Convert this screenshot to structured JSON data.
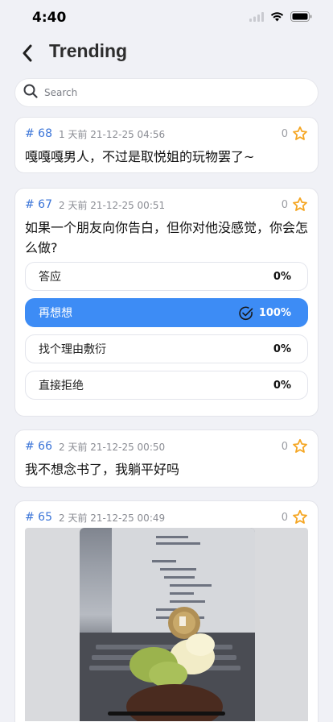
{
  "status": {
    "time": "4:40"
  },
  "header": {
    "title": "Trending"
  },
  "search": {
    "placeholder": "Search"
  },
  "posts": [
    {
      "id": "# 68",
      "meta": "1 天前 21-12-25 04:56",
      "fav_count": "0",
      "text": "嘎嘎嘎男人，不过是取悦姐的玩物罢了~"
    },
    {
      "id": "# 67",
      "meta": "2 天前 21-12-25 00:51",
      "fav_count": "0",
      "text": "如果一个朋友向你告白，但你对他没感觉，你会怎么做?",
      "poll": [
        {
          "label": "答应",
          "percent": "0%",
          "selected": false
        },
        {
          "label": "再想想",
          "percent": "100%",
          "selected": true
        },
        {
          "label": "找个理由敷衍",
          "percent": "0%",
          "selected": false
        },
        {
          "label": "直接拒绝",
          "percent": "0%",
          "selected": false
        }
      ]
    },
    {
      "id": "# 66",
      "meta": "2 天前 21-12-25 00:50",
      "fav_count": "0",
      "text": "我不想念书了，我躺平好吗"
    },
    {
      "id": "# 65",
      "meta": "2 天前 21-12-25 00:49",
      "fav_count": "0",
      "image": "cupcake-photo"
    }
  ],
  "colors": {
    "accent": "#3d8cf5",
    "post_id": "#3a74d8",
    "star": "#f5a623",
    "background": "#f0f1f6"
  }
}
